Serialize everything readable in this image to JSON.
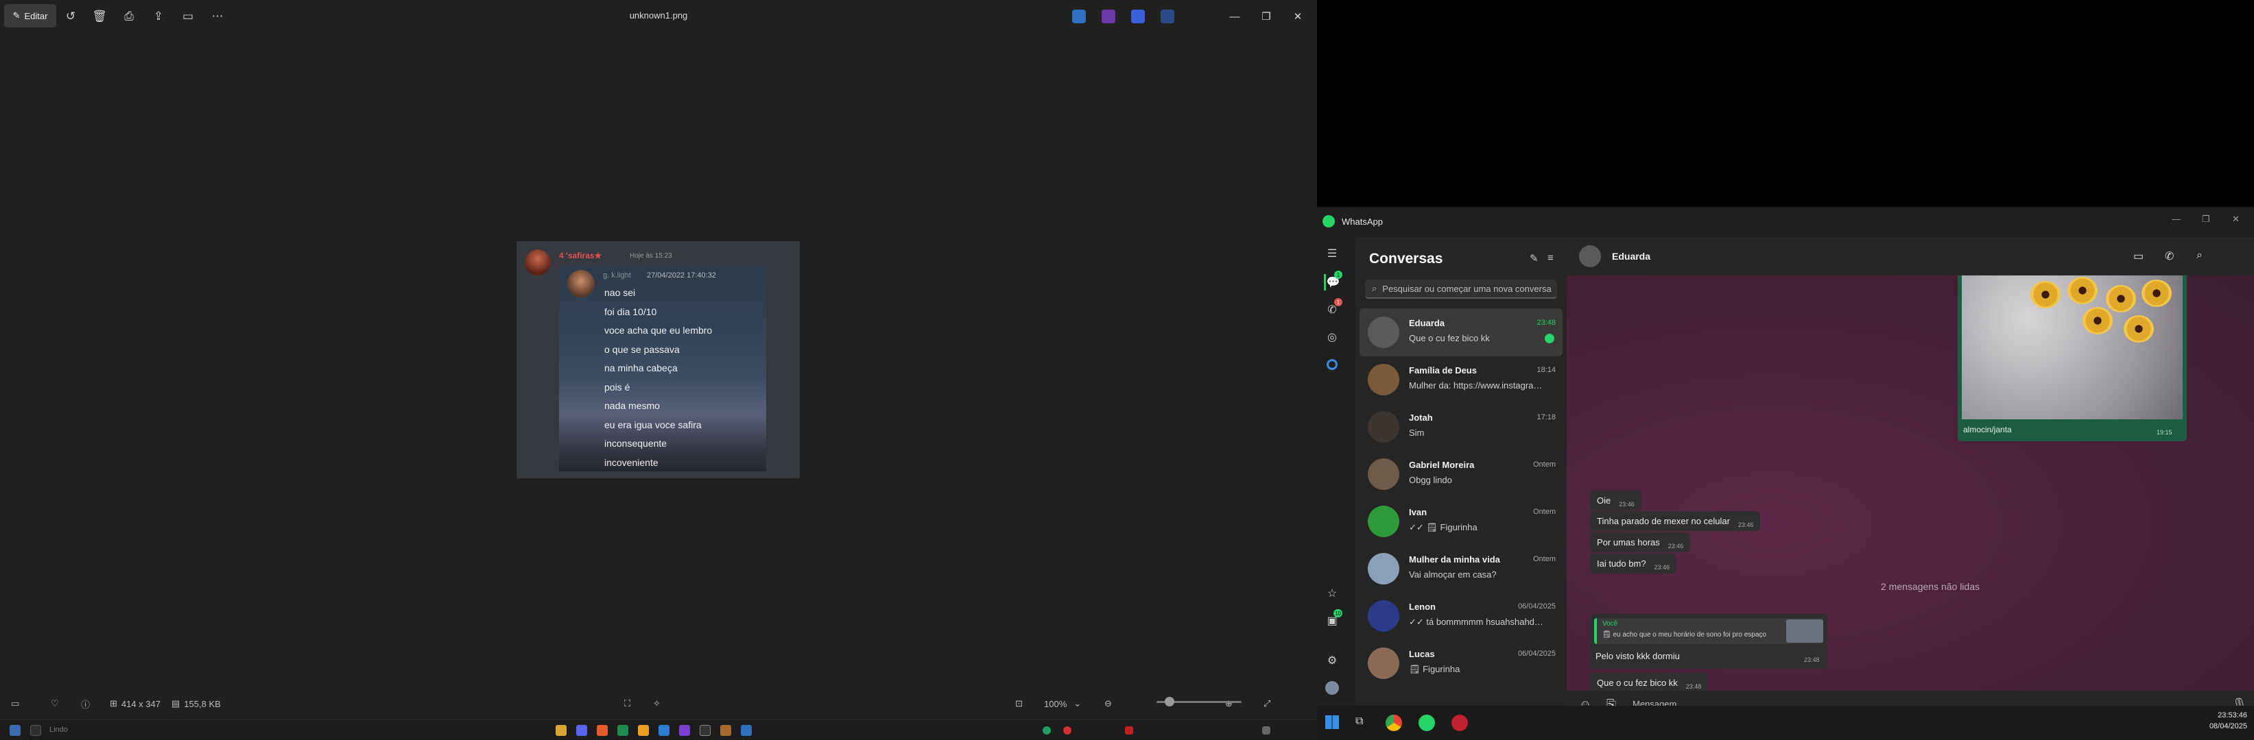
{
  "viewer": {
    "edit_label": "Editar",
    "title": "unknown1.png",
    "dims": "414 x 347",
    "filesize": "155,8 KB",
    "zoom": "100%"
  },
  "photo": {
    "username": "4 'safiras★",
    "timestamp": "Hoje às 15:23",
    "inner_name": "g. k.light",
    "inner_time": "27/04/2022 17:40:32",
    "lines": [
      "nao sei",
      "foi dia 10/10",
      "voce acha que eu lembro",
      "o que se passava",
      "na minha cabeça",
      "pois é",
      "nada mesmo",
      "eu era igua voce safira",
      "inconsequente",
      "incoveniente"
    ]
  },
  "taskbar_left": {
    "search_placeholder": "Lindo"
  },
  "whatsapp": {
    "app_title": "WhatsApp",
    "list_title": "Conversas",
    "search_placeholder": "Pesquisar ou começar uma nova conversa",
    "badges": {
      "chats": "1",
      "calls": "1",
      "bottom": "10"
    },
    "conversations": [
      {
        "name": "Eduarda",
        "time": "23:48",
        "preview": "Que o cu fez bico kk",
        "unread": true,
        "active": true,
        "avatar": "#5a5a5a"
      },
      {
        "name": "Família de Deus",
        "time": "18:14",
        "preview": "Mulher da: https://www.instagram.com/ree...",
        "avatar": "#7b5a3c"
      },
      {
        "name": "Jotah",
        "time": "17:18",
        "preview": "Sim",
        "avatar": "#3d3530"
      },
      {
        "name": "Gabriel Moreira",
        "time": "Ontem",
        "preview": "Obgg lindo",
        "avatar": "#6e5a48"
      },
      {
        "name": "Ivan",
        "time": "Ontem",
        "preview": "✓✓ 🗒 Figurinha",
        "avatar": "#2f9a3a"
      },
      {
        "name": "Mulher da minha vida",
        "time": "Ontem",
        "preview": "Vai almoçar em casa?",
        "avatar": "#8aa0b8"
      },
      {
        "name": "Lenon",
        "time": "06/04/2025",
        "preview": "✓✓ tá bommmmm hsuahshahduahusha",
        "avatar": "#2c3a8a"
      },
      {
        "name": "Lucas",
        "time": "06/04/2025",
        "preview": "🗒 Figurinha",
        "avatar": "#8a6a55"
      }
    ],
    "chat": {
      "contact": "Eduarda",
      "image_caption": "almocin/janta",
      "image_time": "19:15",
      "messages": [
        {
          "text": "Oie",
          "time": "23:46"
        },
        {
          "text": "Tinha parado de mexer no celular",
          "time": "23:46"
        },
        {
          "text": "Por umas horas",
          "time": "23:46"
        },
        {
          "text": "Iai tudo bm?",
          "time": "23:46"
        }
      ],
      "unread_divider": "2 mensagens não lidas",
      "reply": {
        "author": "Você",
        "quoted": "🗒 eu acho que o meu horário de sono foi pro espaço",
        "text": "Pelo visto kkk dormiu",
        "time": "23:48"
      },
      "last_message": {
        "text": "Que o cu fez bico kk",
        "time": "23:48"
      },
      "composer_placeholder": "Mensagem"
    }
  },
  "clock": {
    "time": "23:53:46",
    "date": "08/04/2025"
  },
  "colors": {
    "whatsapp_green": "#25d366",
    "chat_bg": "#4a2139",
    "viewer_bg": "#202020"
  }
}
